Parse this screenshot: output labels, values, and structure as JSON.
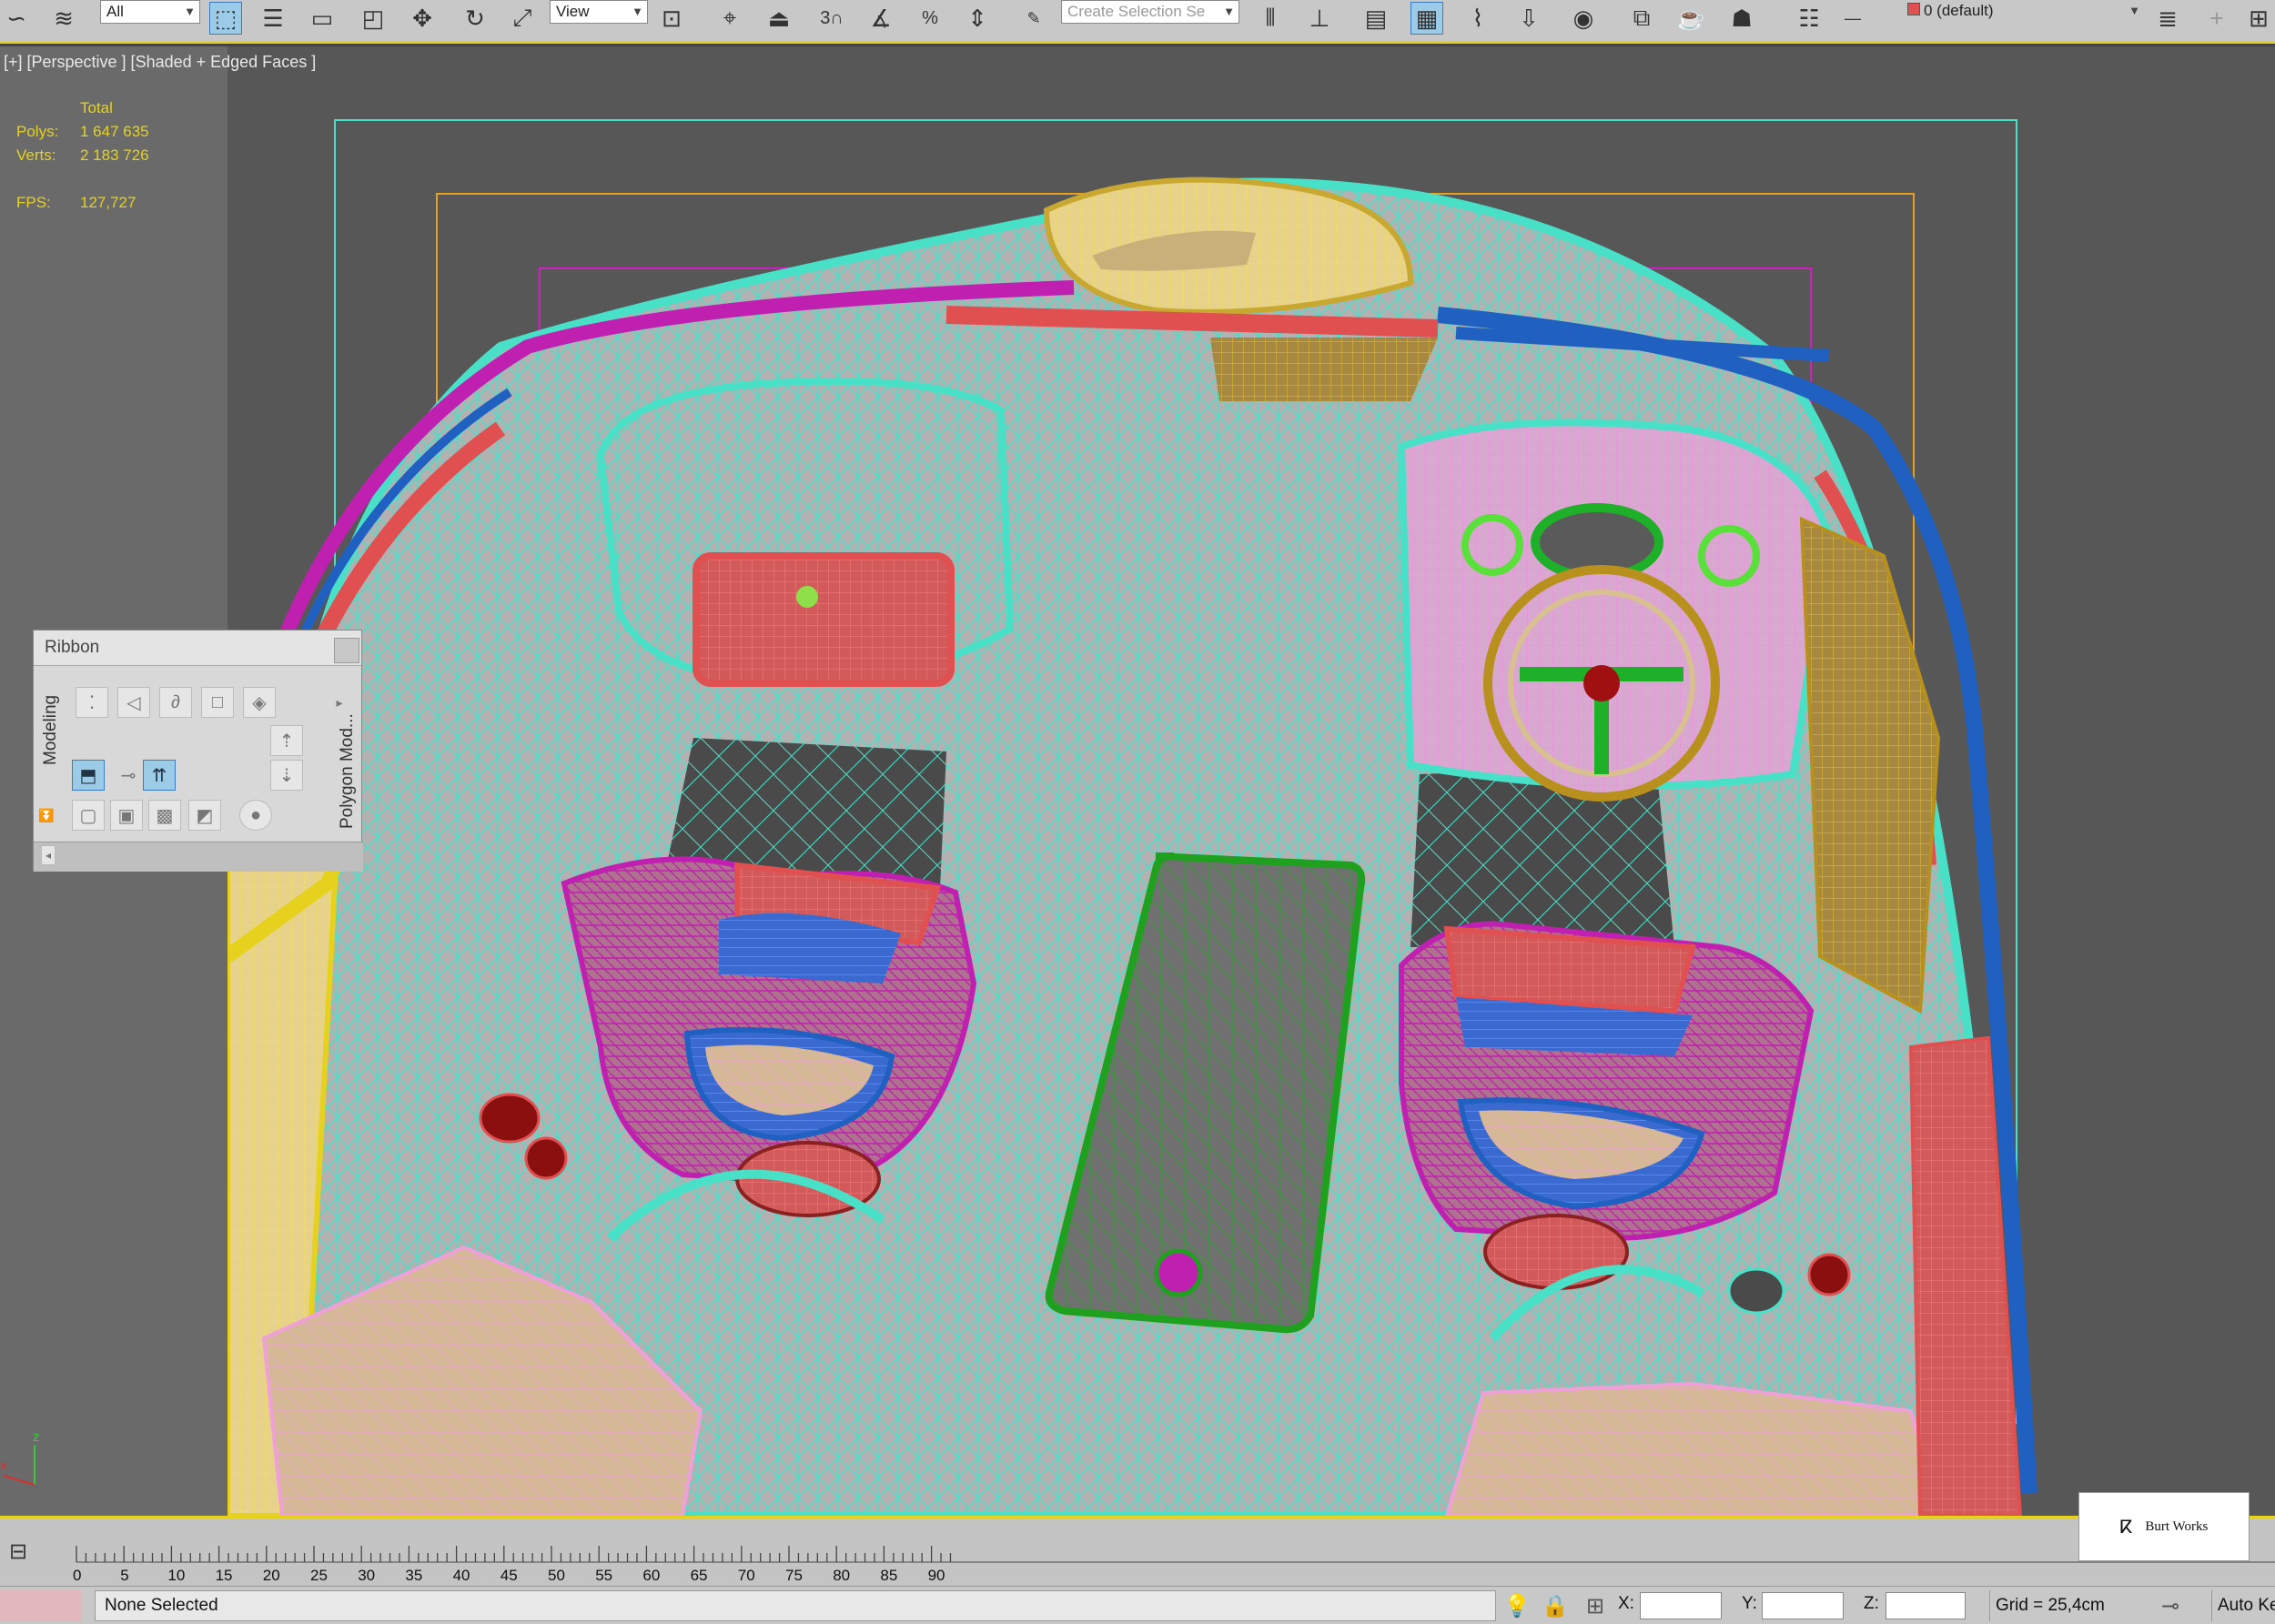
{
  "toolbar": {
    "selection_filter": "All",
    "reference_coord": "View",
    "named_selection_placeholder": "Create Selection Se",
    "snap_count": "3",
    "layer": "0 (default)"
  },
  "viewport": {
    "label": "[+] [Perspective ] [Shaded + Edged Faces ]",
    "stats_header": "Total",
    "polys_label": "Polys:",
    "polys_value": "1 647 635",
    "verts_label": "Verts:",
    "verts_value": "2 183 726",
    "fps_label": "FPS:",
    "fps_value": "127,727",
    "axis_x": "x",
    "axis_z": "z"
  },
  "ribbon": {
    "title": "Ribbon",
    "tab_modeling": "Modeling",
    "tab_polygon": "Polygon Mod..."
  },
  "timeline": {
    "ticks": [
      "0",
      "5",
      "10",
      "15",
      "20",
      "25",
      "30",
      "35",
      "40",
      "45",
      "50",
      "55",
      "60",
      "65",
      "70",
      "75",
      "80",
      "85",
      "90"
    ]
  },
  "status": {
    "message": "None Selected",
    "x_label": "X:",
    "y_label": "Y:",
    "z_label": "Z:",
    "grid": "Grid = 25,4cm",
    "auto_key": "Auto Ke"
  },
  "logo": {
    "text": "Burt Works"
  },
  "colors": {
    "accent_yellow": "#e6d21e",
    "wire_cyan": "#49e0c8",
    "wire_pink": "#e86fd0",
    "wire_red": "#e05050",
    "wire_blue": "#2060c0",
    "wire_magenta": "#c020b0",
    "wire_green": "#20b020",
    "wire_tan": "#d8b888",
    "wire_olive": "#b8901e"
  }
}
